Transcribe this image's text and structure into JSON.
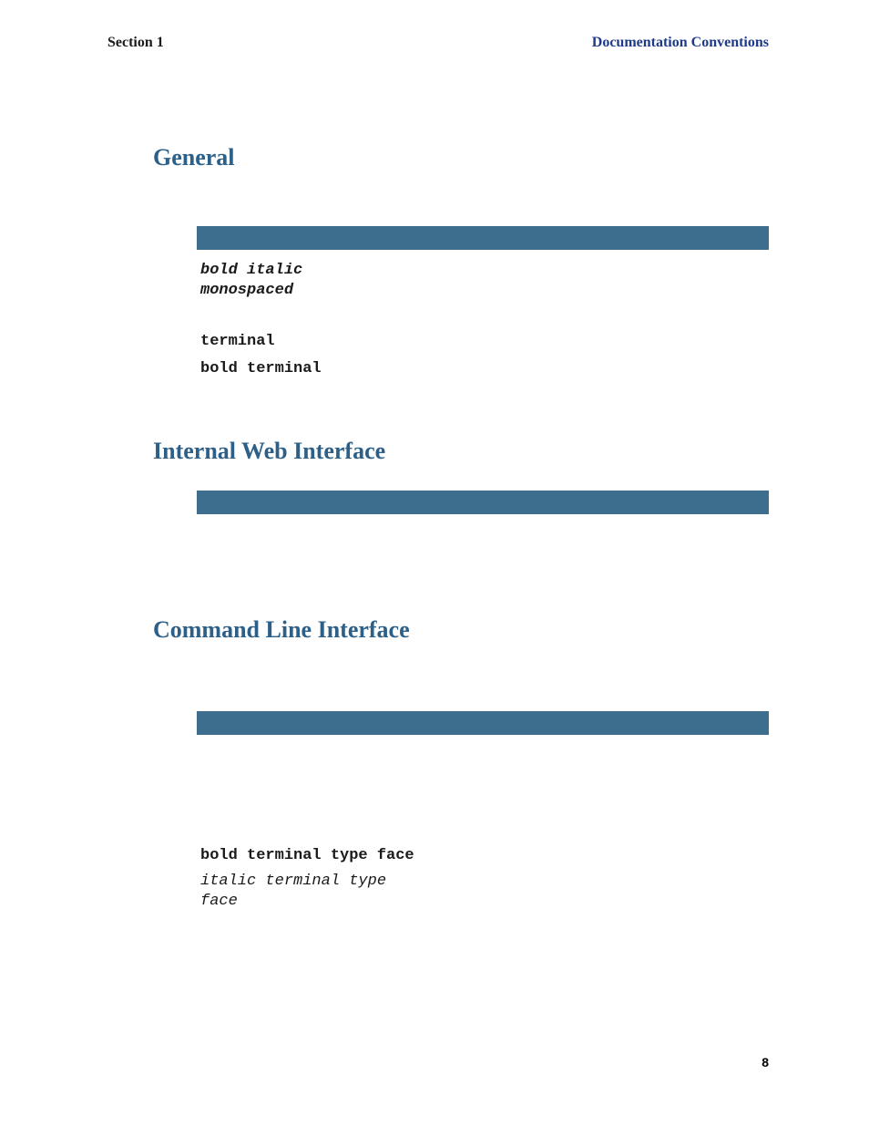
{
  "header": {
    "left": "Section 1",
    "right": "Documentation Conventions"
  },
  "headings": {
    "general": "General",
    "iwi": "Internal Web Interface",
    "cli": "Command Line Interface"
  },
  "general_block": {
    "bold_italic_mono": "bold italic\nmonospaced",
    "terminal": "terminal",
    "bold_terminal": "bold terminal"
  },
  "cli_block": {
    "bold_terminal_typeface": "bold terminal type face",
    "italic_terminal_typeface": "italic terminal type\nface"
  },
  "page_number": "8"
}
